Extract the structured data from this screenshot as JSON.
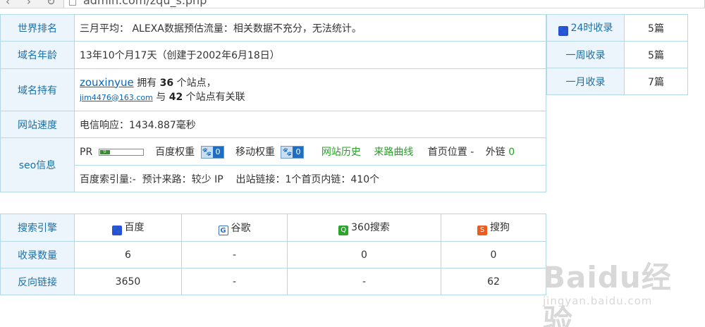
{
  "browser": {
    "url": "admin.com/zqu_s.php"
  },
  "site_info": {
    "world_rank": {
      "label": "世界排名",
      "value": "三月平均： ALEXA数据预估流量：相关数据不充分，无法统计。"
    },
    "domain_age": {
      "label": "域名年龄",
      "value": "13年10个月17天（创建于2002年6月18日）"
    },
    "domain_holder": {
      "label": "域名持有",
      "owner": "zouxinyue",
      "owns_prefix": "拥有",
      "owns_count": "36",
      "owns_suffix": "个站点，",
      "email": "jim4476@163.com",
      "related_prefix": "与",
      "related_count": "42",
      "related_suffix": "个站点有关联"
    },
    "speed": {
      "label": "网站速度",
      "value": "电信响应：1434.887毫秒"
    },
    "seo": {
      "label": "seo信息",
      "pr_label": "PR",
      "pr_value": "0",
      "baidu_weight_label": "百度权重",
      "baidu_weight_value": "0",
      "mobile_weight_label": "移动权重",
      "mobile_weight_value": "0",
      "history_link": "网站历史",
      "traffic_curve_link": "来路曲线",
      "home_position": "首页位置 -",
      "external_links_label": "外链",
      "external_links_value": "0",
      "row2": "百度索引量:-  预计来路：较少 IP    出站链接：1个首页内链：410个"
    }
  },
  "indexing": [
    {
      "label": "24时收录",
      "value": "5篇"
    },
    {
      "label": "一周收录",
      "value": "5篇"
    },
    {
      "label": "一月收录",
      "value": "7篇"
    }
  ],
  "engines": {
    "header": {
      "label": "搜索引擎",
      "cols": [
        "百度",
        "谷歌",
        "360搜索",
        "搜狗"
      ]
    },
    "rows": [
      {
        "label": "收录数量",
        "values": [
          "6",
          "-",
          "0",
          "0"
        ]
      },
      {
        "label": "反向链接",
        "values": [
          "3650",
          "-",
          "-",
          "62"
        ]
      }
    ]
  },
  "watermark": {
    "main": "Baidu经验",
    "sub": "jingyan.baidu.com"
  },
  "icons": {
    "baidu": "paw-icon",
    "google": "google-icon",
    "s360": "360-search-icon",
    "sogou": "sogou-icon"
  },
  "colors": {
    "label_bg": "#ebf5fb",
    "label_text": "#1c6fa8",
    "border": "#b3d8e8",
    "green_link": "#25a025"
  }
}
